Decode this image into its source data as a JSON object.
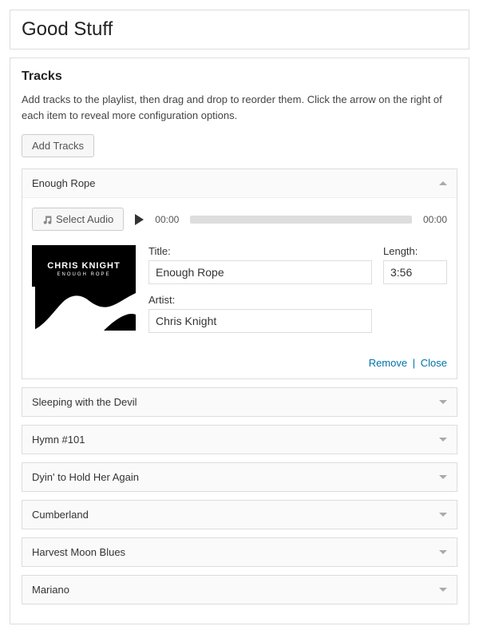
{
  "page_title": "Good Stuff",
  "panel": {
    "heading": "Tracks",
    "description": "Add tracks to the playlist, then drag and drop to reorder them. Click the arrow on the right of each item to reveal more configuration options.",
    "add_btn": "Add Tracks"
  },
  "select_audio_btn": "Select Audio",
  "player": {
    "current": "00:00",
    "total": "00:00"
  },
  "fields": {
    "title_label": "Title:",
    "length_label": "Length:",
    "artist_label": "Artist:"
  },
  "actions": {
    "remove": "Remove",
    "close": "Close"
  },
  "art": {
    "line1": "CHRIS KNIGHT",
    "line2": "ENOUGH ROPE"
  },
  "tracks": [
    {
      "name": "Enough Rope",
      "title": "Enough Rope",
      "artist": "Chris Knight",
      "length": "3:56",
      "expanded": true
    },
    {
      "name": "Sleeping with the Devil",
      "expanded": false
    },
    {
      "name": "Hymn #101",
      "expanded": false
    },
    {
      "name": "Dyin' to Hold Her Again",
      "expanded": false
    },
    {
      "name": "Cumberland",
      "expanded": false
    },
    {
      "name": "Harvest Moon Blues",
      "expanded": false
    },
    {
      "name": "Mariano",
      "expanded": false
    }
  ]
}
